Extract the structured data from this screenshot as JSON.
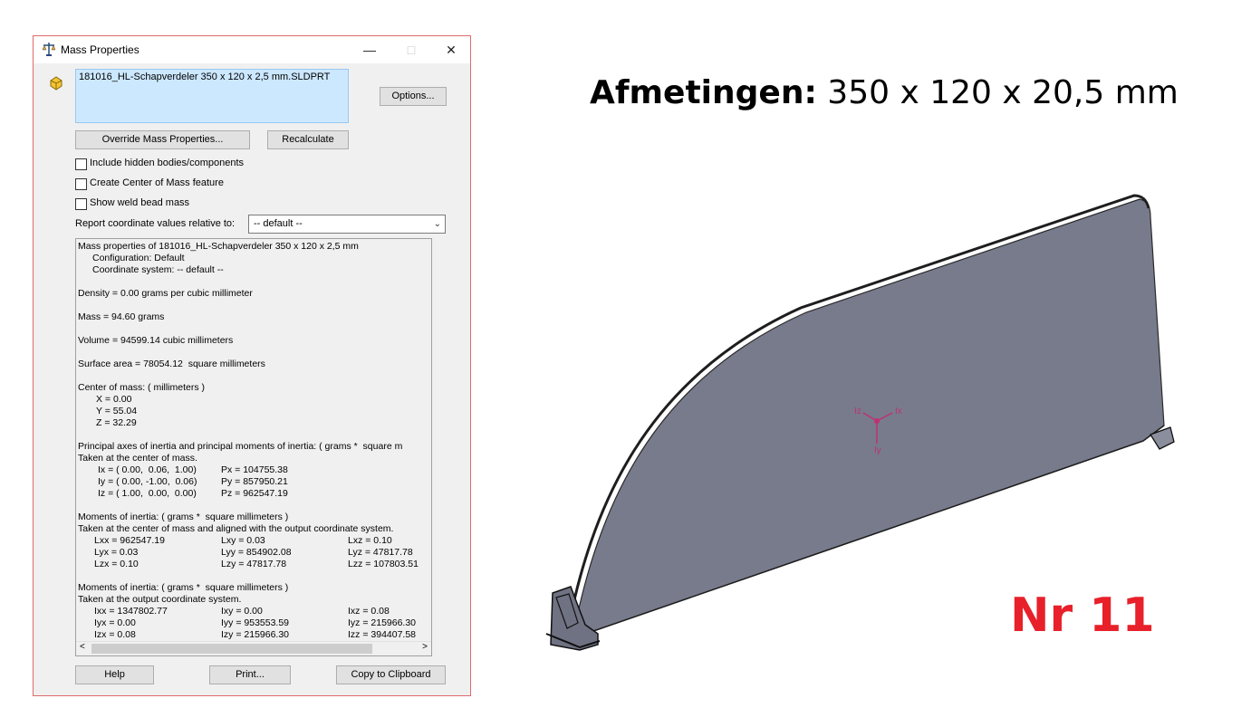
{
  "window": {
    "title": "Mass Properties",
    "minimize_icon": "minimize-icon",
    "maximize_icon": "maximize-icon",
    "close_icon": "close-icon"
  },
  "selection": {
    "item": "181016_HL-Schapverdeler 350 x 120 x 2,5 mm.SLDPRT"
  },
  "buttons": {
    "options": "Options...",
    "override": "Override Mass Properties...",
    "recalculate": "Recalculate",
    "help": "Help",
    "print": "Print...",
    "copy": "Copy to Clipboard"
  },
  "checkboxes": {
    "hidden": {
      "label": "Include hidden bodies/components",
      "checked": false
    },
    "center": {
      "label": "Create Center of Mass feature",
      "checked": false
    },
    "weld": {
      "label": "Show weld bead mass",
      "checked": false
    }
  },
  "coord": {
    "label": "Report coordinate values relative to:",
    "value": "-- default --"
  },
  "results": {
    "header": "Mass properties of 181016_HL-Schapverdeler 350 x 120 x 2,5 mm",
    "config": "Configuration: Default",
    "coordsys": "Coordinate system: -- default --",
    "density": "Density = 0.00 grams per cubic millimeter",
    "mass": "Mass = 94.60 grams",
    "volume": "Volume = 94599.14 cubic millimeters",
    "surface": "Surface area = 78054.12  square millimeters",
    "com_header": "Center of mass: ( millimeters )",
    "com_x": "X = 0.00",
    "com_y": "Y = 55.04",
    "com_z": "Z = 32.29",
    "pa_header": "Principal axes of inertia and principal moments of inertia: ( grams *  square m",
    "pa_taken": "Taken at the center of mass.",
    "ix": "Ix = ( 0.00,  0.06,  1.00)",
    "iy": "Iy = ( 0.00, -1.00,  0.06)",
    "iz": "Iz = ( 1.00,  0.00,  0.00)",
    "px": "Px = 104755.38",
    "py": "Py = 857950.21",
    "pz": "Pz = 962547.19",
    "m1_header": "Moments of inertia: ( grams *  square millimeters )",
    "m1_taken": "Taken at the center of mass and aligned with the output coordinate system.",
    "lxx": "Lxx = 962547.19",
    "lxy": "Lxy = 0.03",
    "lxz": "Lxz = 0.10",
    "lyx": "Lyx = 0.03",
    "lyy": "Lyy = 854902.08",
    "lyz": "Lyz = 47817.78",
    "lzx": "Lzx = 0.10",
    "lzy": "Lzy = 47817.78",
    "lzz": "Lzz = 107803.51",
    "m2_header": "Moments of inertia: ( grams *  square millimeters )",
    "m2_taken": "Taken at the output coordinate system.",
    "ixx": "Ixx = 1347802.77",
    "ixy": "Ixy = 0.00",
    "ixz": "Ixz = 0.08",
    "iyx": "Iyx = 0.00",
    "iyy": "Iyy = 953553.59",
    "iyz": "Iyz = 215966.30",
    "izx": "Izx = 0.08",
    "izy": "Izy = 215966.30",
    "izz": "Izz = 394407.58"
  },
  "heading": {
    "label": "Afmetingen:",
    "value": " 350 x 120 x 20,5 mm"
  },
  "number_label": "Nr 11",
  "triad": {
    "x": "Ix",
    "y": "Iy",
    "z": "Iz"
  },
  "colors": {
    "accent_red": "#e8202a",
    "model": "#787b8c",
    "selection": "#cce8ff"
  }
}
